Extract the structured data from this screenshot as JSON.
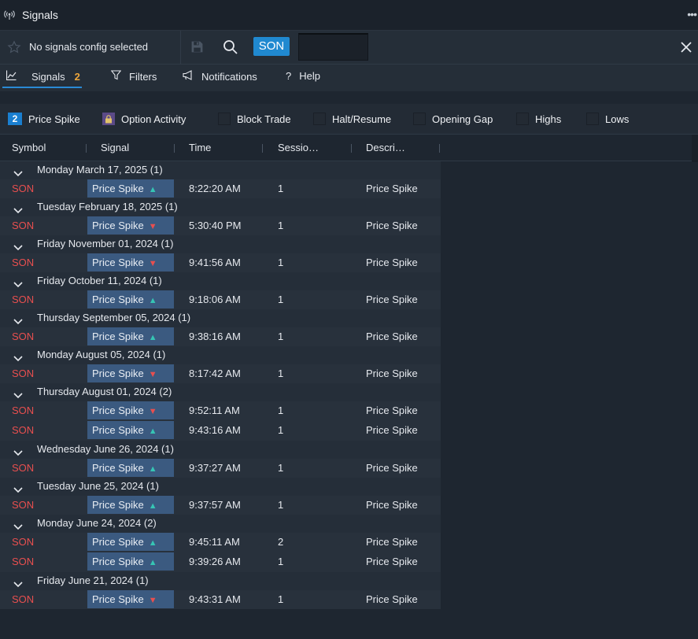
{
  "window": {
    "title": "Signals",
    "more_label": "•••"
  },
  "toolbar": {
    "config_label": "No signals config selected",
    "ticker": "SON",
    "ticker_input_value": ""
  },
  "tabs": [
    {
      "label": "Signals",
      "count": "2",
      "icon": "line-chart-icon"
    },
    {
      "label": "Filters",
      "icon": "filter-icon"
    },
    {
      "label": "Notifications",
      "icon": "megaphone-icon"
    },
    {
      "label": "Help",
      "icon": "question-icon"
    }
  ],
  "chips": [
    {
      "label": "Price Spike",
      "badge": "2",
      "color": "#3b5a80",
      "active": true
    },
    {
      "label": "Option Activity",
      "badge": "🔒",
      "color": "#5b4a87"
    },
    {
      "label": "Block Trade",
      "badge": "",
      "color": "#6b5a45"
    },
    {
      "label": "Halt/Resume",
      "badge": "",
      "color": "#6e7048"
    },
    {
      "label": "Opening Gap",
      "badge": "",
      "color": "#3c6c72"
    },
    {
      "label": "Highs",
      "badge": "",
      "color": "#2f6a5c"
    },
    {
      "label": "Lows",
      "badge": "",
      "color": "#7a3a3a"
    }
  ],
  "columns": [
    "Symbol",
    "Signal",
    "Time",
    "Sessio…",
    "Descri…"
  ],
  "groups": [
    {
      "title": "Monday March 17, 2025 (1)",
      "rows": [
        {
          "symbol": "SON",
          "signal": "Price Spike",
          "dir": "up",
          "time": "8:22:20 AM",
          "session": "1",
          "desc": "Price Spike"
        }
      ]
    },
    {
      "title": "Tuesday February 18, 2025 (1)",
      "rows": [
        {
          "symbol": "SON",
          "signal": "Price Spike",
          "dir": "down",
          "time": "5:30:40 PM",
          "session": "1",
          "desc": "Price Spike"
        }
      ]
    },
    {
      "title": "Friday November 01, 2024 (1)",
      "rows": [
        {
          "symbol": "SON",
          "signal": "Price Spike",
          "dir": "down",
          "time": "9:41:56 AM",
          "session": "1",
          "desc": "Price Spike"
        }
      ]
    },
    {
      "title": "Friday October 11, 2024 (1)",
      "rows": [
        {
          "symbol": "SON",
          "signal": "Price Spike",
          "dir": "up",
          "time": "9:18:06 AM",
          "session": "1",
          "desc": "Price Spike"
        }
      ]
    },
    {
      "title": "Thursday September 05, 2024 (1)",
      "rows": [
        {
          "symbol": "SON",
          "signal": "Price Spike",
          "dir": "up",
          "time": "9:38:16 AM",
          "session": "1",
          "desc": "Price Spike"
        }
      ]
    },
    {
      "title": "Monday August 05, 2024 (1)",
      "rows": [
        {
          "symbol": "SON",
          "signal": "Price Spike",
          "dir": "down",
          "time": "8:17:42 AM",
          "session": "1",
          "desc": "Price Spike"
        }
      ]
    },
    {
      "title": "Thursday August 01, 2024 (2)",
      "rows": [
        {
          "symbol": "SON",
          "signal": "Price Spike",
          "dir": "down",
          "time": "9:52:11 AM",
          "session": "1",
          "desc": "Price Spike"
        },
        {
          "symbol": "SON",
          "signal": "Price Spike",
          "dir": "up",
          "time": "9:43:16 AM",
          "session": "1",
          "desc": "Price Spike"
        }
      ]
    },
    {
      "title": "Wednesday June 26, 2024 (1)",
      "rows": [
        {
          "symbol": "SON",
          "signal": "Price Spike",
          "dir": "up",
          "time": "9:37:27 AM",
          "session": "1",
          "desc": "Price Spike"
        }
      ]
    },
    {
      "title": "Tuesday June 25, 2024 (1)",
      "rows": [
        {
          "symbol": "SON",
          "signal": "Price Spike",
          "dir": "up",
          "time": "9:37:57 AM",
          "session": "1",
          "desc": "Price Spike"
        }
      ]
    },
    {
      "title": "Monday June 24, 2024 (2)",
      "rows": [
        {
          "symbol": "SON",
          "signal": "Price Spike",
          "dir": "up",
          "time": "9:45:11 AM",
          "session": "2",
          "desc": "Price Spike"
        },
        {
          "symbol": "SON",
          "signal": "Price Spike",
          "dir": "up",
          "time": "9:39:26 AM",
          "session": "1",
          "desc": "Price Spike"
        }
      ]
    },
    {
      "title": "Friday June 21, 2024 (1)",
      "rows": [
        {
          "symbol": "SON",
          "signal": "Price Spike",
          "dir": "down",
          "time": "9:43:31 AM",
          "session": "1",
          "desc": "Price Spike"
        }
      ]
    }
  ]
}
